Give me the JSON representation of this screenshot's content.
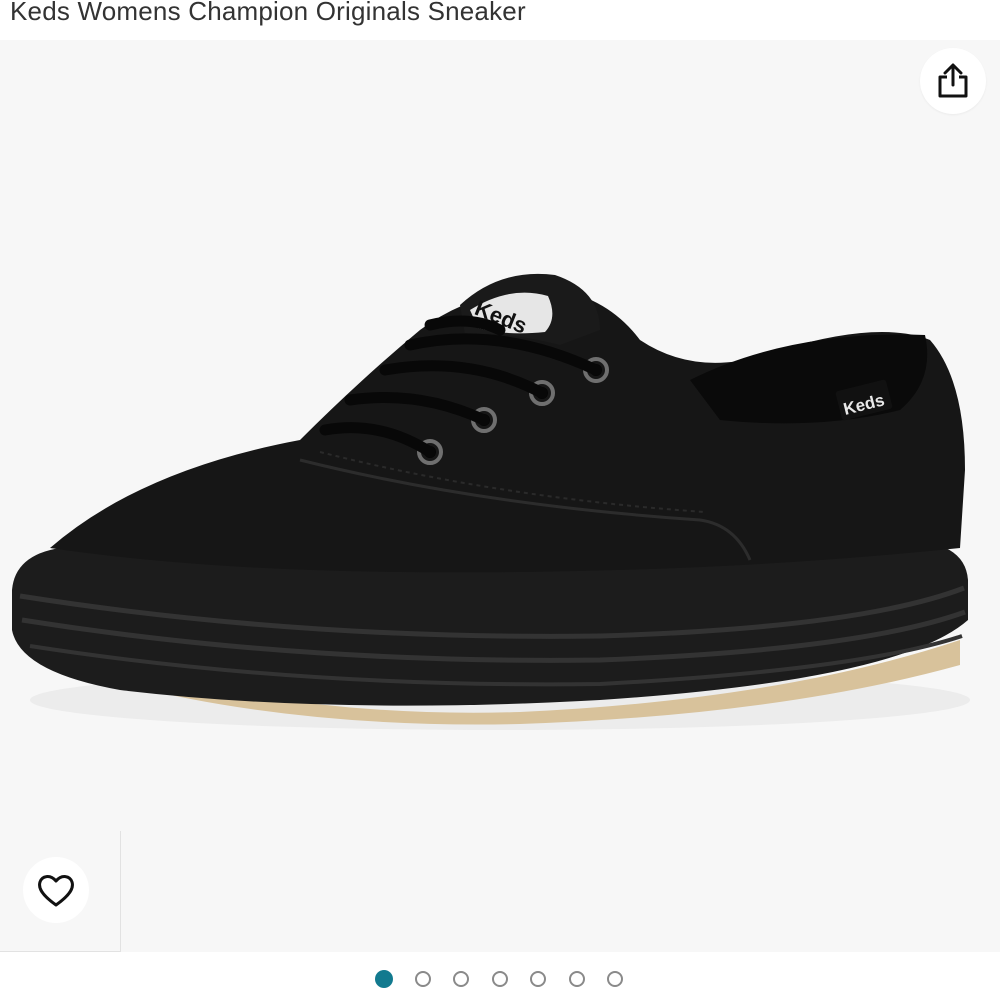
{
  "product": {
    "title": "Keds Womens Champion Originals Sneaker",
    "brand_label": "Keds"
  },
  "gallery": {
    "share_icon": "share-icon",
    "wishlist_icon": "heart-outline-icon",
    "image_count": 7,
    "active_index": 0,
    "accent_color": "#127a8f"
  }
}
